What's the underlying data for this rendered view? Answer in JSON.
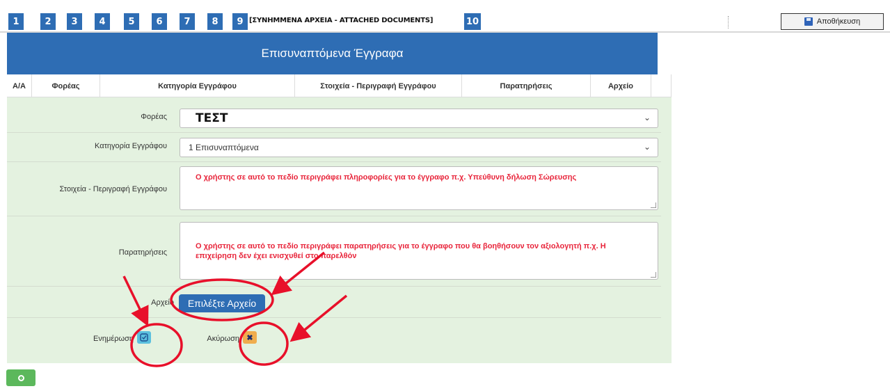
{
  "tabs": [
    "1",
    "2",
    "3",
    "4",
    "5",
    "6",
    "7",
    "8",
    "9",
    "10"
  ],
  "active_tab_label": "[ΣΥΝΗΜΜΕΝΑ ΑΡΧΕΙΑ - ATTACHED DOCUMENTS]",
  "save_label": "Αποθήκευση",
  "panel_title": "Επισυναπτόμενα Έγγραφα",
  "columns": [
    "Α/Α",
    "Φορέας",
    "Κατηγορία Εγγράφου",
    "Στοιχεία - Περιγραφή Εγγράφου",
    "Παρατηρήσεις",
    "Αρχείο"
  ],
  "form": {
    "foreas_label": "Φορέας",
    "foreas_value": "ΤΕΣΤ",
    "category_label": "Κατηγορία Εγγράφου",
    "category_value": "1 Επισυναπτόμενα",
    "description_label": "Στοιχεία - Περιγραφή Εγγράφου",
    "description_value": "Ο χρήστης σε αυτό το πεδίο περιγράφει πληροφορίες για το έγγραφο π.χ. Υπεύθυνη δήλωση Σώρευσης",
    "notes_label": "Παρατηρήσεις",
    "notes_value": "Ο χρήστης σε αυτό το πεδίο περιγράφει παρατηρήσεις για το έγγραφο που θα βοηθήσουν τον αξιολογητή π.χ. Η επιχείρηση δεν έχει ενισχυθεί στο παρελθόν",
    "file_label": "Αρχείο",
    "file_button": "Επιλέξτε Αρχείο",
    "update_label": "Ενημέρωση",
    "cancel_label": "Ακύρωση"
  },
  "icons": {
    "save": "floppy-disk-icon",
    "update": "check-square-icon",
    "cancel": "close-icon",
    "add": "plus-circle-icon",
    "dropdown": "chevron-down-icon"
  },
  "colors": {
    "primary": "#2e6db4",
    "form_bg": "#e4f2e0",
    "annotation": "#e8102a",
    "info": "#5bc0de",
    "warning": "#f0ad4e",
    "success": "#5cb85c"
  }
}
